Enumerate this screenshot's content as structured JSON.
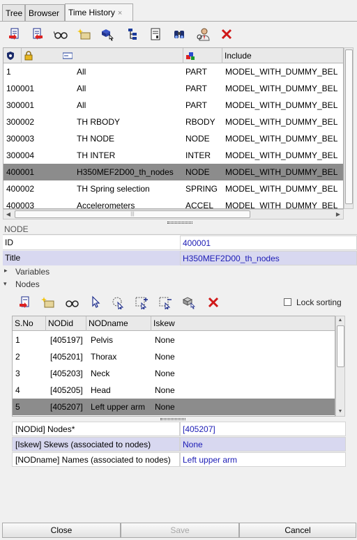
{
  "tabs": [
    {
      "label": "Tree"
    },
    {
      "label": "Browser"
    },
    {
      "label": "Time History",
      "close": "×"
    }
  ],
  "toolbar": {
    "icons": [
      "import-icon",
      "export-icon",
      "review-icon",
      "create-icon",
      "select-icon",
      "tree-icon",
      "card-icon",
      "find-icon",
      "user-icon",
      "delete-icon"
    ]
  },
  "grid": {
    "columns": [
      "",
      "",
      "",
      "",
      "Include"
    ],
    "rows": [
      [
        "1",
        "All",
        "PART",
        "MODEL_WITH_DUMMY_BEL"
      ],
      [
        "100001",
        "All",
        "PART",
        "MODEL_WITH_DUMMY_BEL"
      ],
      [
        "300001",
        "All",
        "PART",
        "MODEL_WITH_DUMMY_BEL"
      ],
      [
        "300002",
        "TH RBODY",
        "RBODY",
        "MODEL_WITH_DUMMY_BEL"
      ],
      [
        "300003",
        "TH NODE",
        "NODE",
        "MODEL_WITH_DUMMY_BEL"
      ],
      [
        "300004",
        "TH INTER",
        "INTER",
        "MODEL_WITH_DUMMY_BEL"
      ],
      [
        "400001",
        "H350MEF2D00_th_nodes",
        "NODE",
        "MODEL_WITH_DUMMY_BEL"
      ],
      [
        "400002",
        "TH Spring selection",
        "SPRING",
        "MODEL_WITH_DUMMY_BEL"
      ],
      [
        "400003",
        "Accelerometers",
        "ACCEL",
        "MODEL_WITH_DUMMY_BEL"
      ]
    ],
    "selected_row": 6,
    "scroll_thumb_marker": "|||"
  },
  "detail": {
    "section_title": "NODE",
    "id_label": "ID",
    "id_value": "400001",
    "title_label": "Title",
    "title_value": "H350MEF2D00_th_nodes",
    "variables_label": "Variables",
    "nodes_label": "Nodes",
    "lock_sorting": "Lock sorting"
  },
  "nodes": {
    "columns": [
      "S.No",
      "NODid",
      "NODname",
      "Iskew"
    ],
    "rows": [
      [
        "1",
        "[405197]",
        "Pelvis",
        "None"
      ],
      [
        "2",
        "[405201]",
        "Thorax",
        "None"
      ],
      [
        "3",
        "[405203]",
        "Neck",
        "None"
      ],
      [
        "4",
        "[405205]",
        "Head",
        "None"
      ],
      [
        "5",
        "[405207]",
        "Left upper arm",
        "None"
      ]
    ],
    "selected_row": 4
  },
  "attrs": [
    {
      "label": "[NODid] Nodes*",
      "value": "[405207]"
    },
    {
      "label": "[Iskew] Skews (associated to nodes)",
      "value": "None"
    },
    {
      "label": "[NODname] Names (associated to nodes)",
      "value": "Left upper arm"
    }
  ],
  "buttons": {
    "close": "Close",
    "save": "Save",
    "cancel": "Cancel"
  },
  "colors": {
    "selection": "#8c8c8c",
    "value_text": "#1b1bb5",
    "highlight_row": "#d8d8f0"
  }
}
